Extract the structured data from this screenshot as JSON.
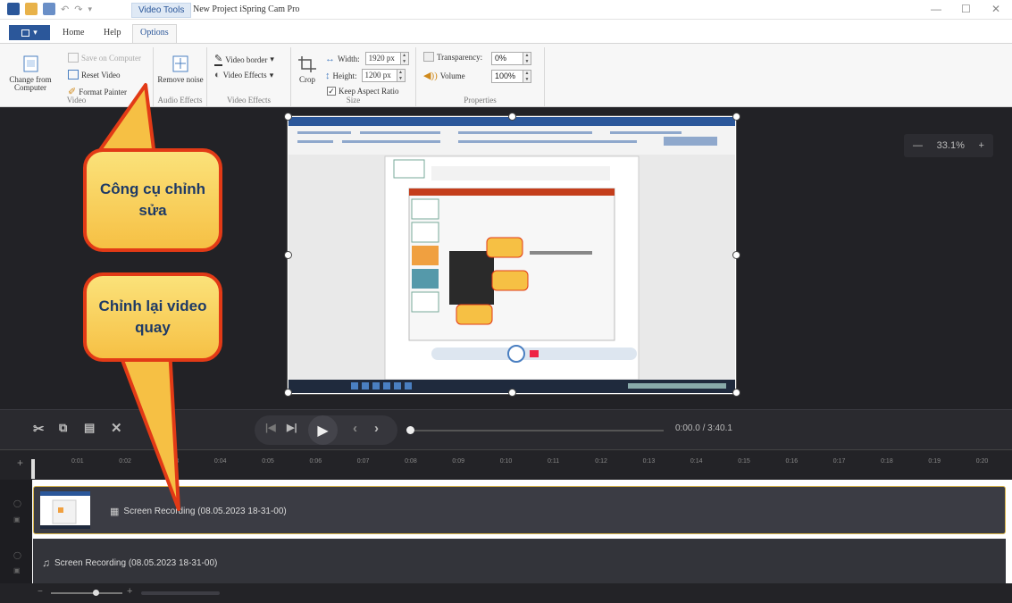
{
  "window": {
    "context_tab": "Video Tools",
    "title": "New Project  iSpring Cam Pro",
    "controls": [
      "—",
      "☐",
      "✕"
    ]
  },
  "ribbon": {
    "tabs": [
      "Home",
      "Help",
      "Options"
    ],
    "active_tab": "Options",
    "video": {
      "change_from_computer": "Change from Computer",
      "save_on_computer": "Save on Computer",
      "reset_video": "Reset Video",
      "format_painter": "Format Painter",
      "group_label": "Video"
    },
    "audio_effects": {
      "remove_noise": "Remove noise",
      "group_label": "Audio Effects"
    },
    "video_effects": {
      "video_border": "Video border",
      "video_effects": "Video Effects",
      "group_label": "Video Effects"
    },
    "size": {
      "crop": "Crop",
      "width_label": "Width:",
      "width_value": "1920 px",
      "height_label": "Height:",
      "height_value": "1200 px",
      "keep_aspect": "Keep Aspect Ratio",
      "group_label": "Size"
    },
    "properties": {
      "transparency_label": "Transparency:",
      "transparency_value": "0%",
      "volume_label": "Volume",
      "volume_value": "100%",
      "group_label": "Properties"
    }
  },
  "editor": {
    "zoom_minus": "—",
    "zoom_value": "33.1%",
    "zoom_plus": "+"
  },
  "callouts": {
    "edit_tools": "Công cụ chỉnh sửa",
    "edit_video": "Chỉnh lại video quay"
  },
  "playback": {
    "time": "0:00.0 / 3:40.1"
  },
  "timeline": {
    "ticks": [
      "0:01",
      "0:02",
      "0:03",
      "0:04",
      "0:05",
      "0:06",
      "0:07",
      "0:08",
      "0:09",
      "0:10",
      "0:11",
      "0:12",
      "0:13",
      "0:14",
      "0:15",
      "0:16",
      "0:17",
      "0:18",
      "0:19",
      "0:20"
    ],
    "video_track": "Screen Recording (08.05.2023 18-31-00)",
    "audio_track": "Screen Recording (08.05.2023 18-31-00)"
  },
  "colors": {
    "ribbon_blue": "#2b579a",
    "callout_fill": "#f6c044",
    "callout_border": "#e23a16",
    "editor_bg": "#222226"
  }
}
